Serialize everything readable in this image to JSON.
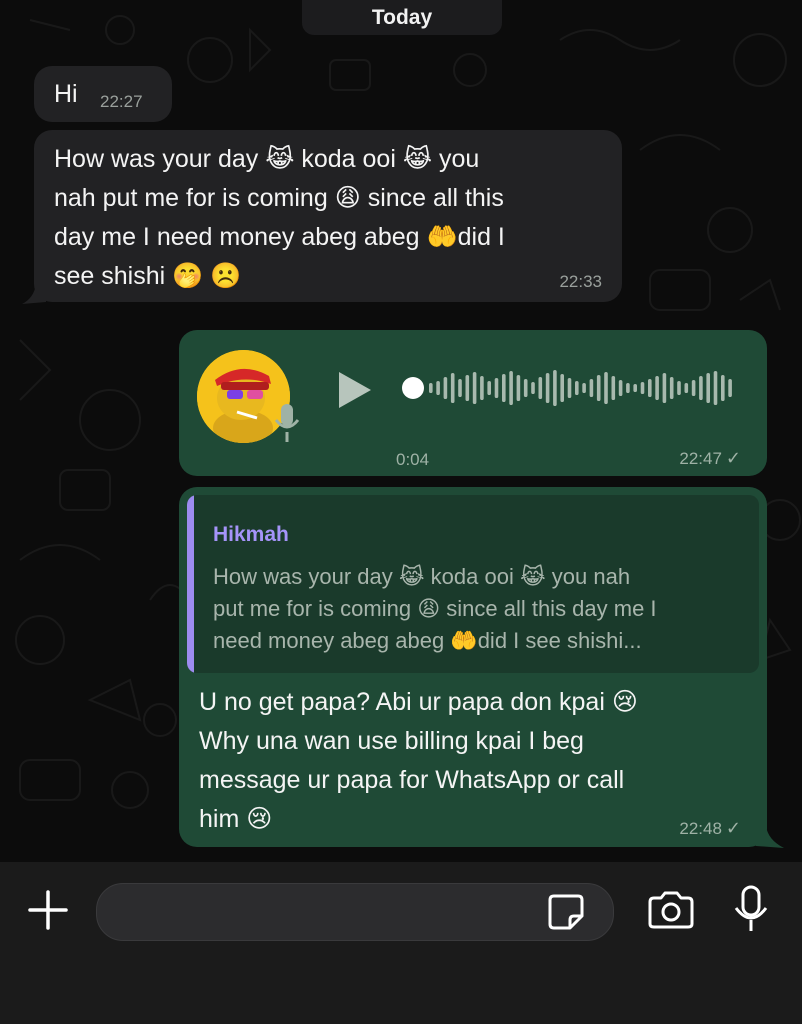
{
  "date_divider": "Today",
  "messages": {
    "m1": {
      "text": "Hi",
      "time": "22:27"
    },
    "m2": {
      "lines": [
        "How was your day 😹 koda ooi 😹 you",
        "nah put me for is coming 😩 since all this",
        "day me I need money abeg abeg 🤲did I",
        "see shishi 🤭 ☹️"
      ],
      "time": "22:33"
    },
    "voice": {
      "duration": "0:04",
      "time": "22:47",
      "status": "✓",
      "progress": 0.0
    },
    "reply": {
      "quoted_author": "Hikmah",
      "quoted_lines": [
        "How was your day 😹 koda ooi 😹 you nah",
        "put me for is coming 😩 since all this day me I",
        "need money abeg abeg 🤲did I see shishi..."
      ],
      "lines": [
        "U no get papa? Abi ur papa don kpai 😢",
        "Why una wan use billing kpai I beg",
        "message ur papa for WhatsApp or call",
        "him 😢"
      ],
      "time": "22:48",
      "status": "✓"
    }
  },
  "composer": {
    "placeholder": ""
  },
  "icons": {
    "add": "plus-icon",
    "sticker": "sticker-icon",
    "camera": "camera-icon",
    "mic": "microphone-icon",
    "play": "play-icon"
  },
  "colors": {
    "incoming_bubble": "#222224",
    "outgoing_bubble": "#1f4a36",
    "quote_accent": "#9d8cf0",
    "background": "#0c0c0c"
  }
}
